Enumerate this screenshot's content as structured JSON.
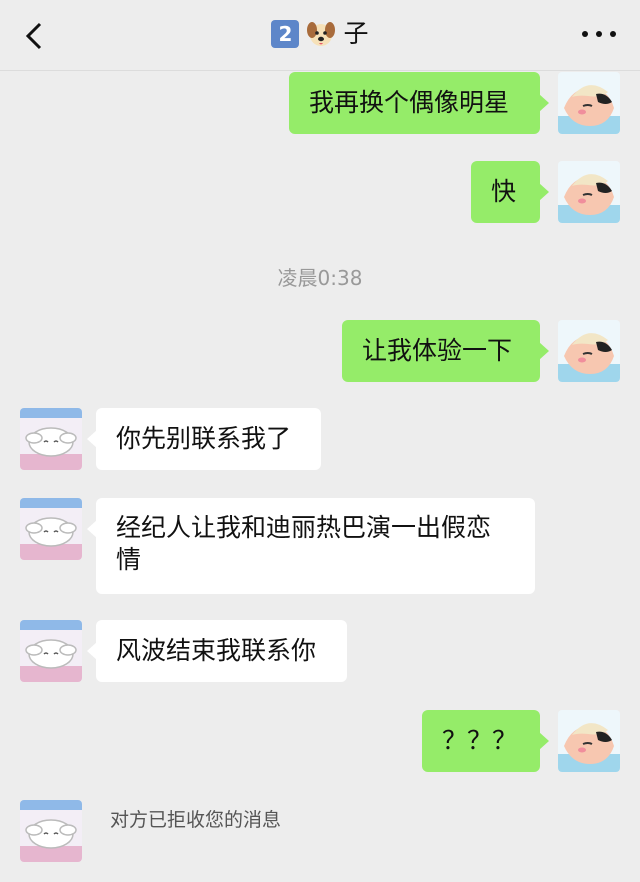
{
  "header": {
    "badge": "2",
    "title_suffix": "子",
    "back_icon": "chevron-left-icon",
    "more_icon": "more-dots-icon"
  },
  "messages": [
    {
      "side": "me",
      "text": "我再换个偶像明星"
    },
    {
      "side": "me",
      "text": "快"
    },
    {
      "side": "me",
      "text": "让我体验一下"
    },
    {
      "side": "them",
      "text": "你先别联系我了"
    },
    {
      "side": "them",
      "text": "经纪人让我和迪丽热巴演一出假恋情"
    },
    {
      "side": "them",
      "text": "风波结束我联系你"
    },
    {
      "side": "me",
      "text": "？？？"
    }
  ],
  "timestamp": "凌晨0:38",
  "system_message": "对方已拒收您的消息",
  "colors": {
    "my_bubble": "#95ec69",
    "their_bubble": "#ffffff",
    "background": "#ededed"
  }
}
